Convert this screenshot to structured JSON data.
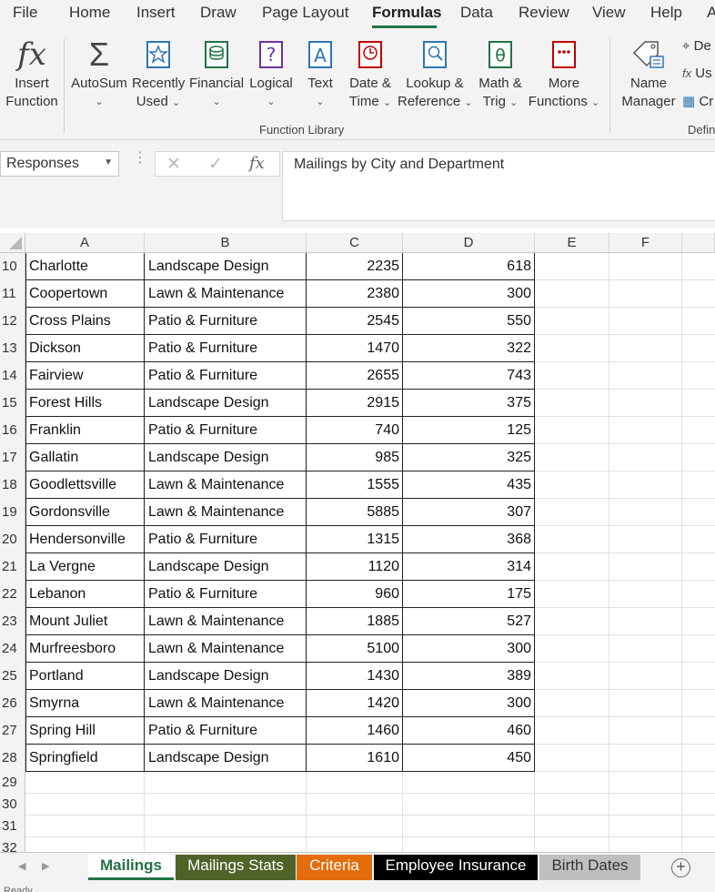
{
  "menu": {
    "tabs": [
      "File",
      "Home",
      "Insert",
      "Draw",
      "Page Layout",
      "Formulas",
      "Data",
      "Review",
      "View",
      "Help",
      "A"
    ],
    "active": "Formulas"
  },
  "ribbon": {
    "insert_function": [
      "Insert",
      "Function"
    ],
    "autosum": "AutoSum",
    "recently_used": [
      "Recently",
      "Used"
    ],
    "financial": "Financial",
    "logical": "Logical",
    "text": "Text",
    "date_time": [
      "Date &",
      "Time"
    ],
    "lookup": [
      "Lookup &",
      "Reference"
    ],
    "math": [
      "Math &",
      "Trig"
    ],
    "more": [
      "More",
      "Functions"
    ],
    "group_label": "Function Library",
    "name_manager": [
      "Name",
      "Manager"
    ],
    "defined_names": [
      "De",
      "Us",
      "Cr"
    ],
    "defined_group_label": "Defin"
  },
  "formula_bar": {
    "name_box": "Responses",
    "fx": "fx",
    "content": "Mailings by City and Department"
  },
  "grid": {
    "columns": [
      "A",
      "B",
      "C",
      "D",
      "E",
      "F"
    ],
    "rows": [
      {
        "row": "10",
        "city": "Charlotte",
        "dept": "Landscape Design",
        "c": "2235",
        "d": "618"
      },
      {
        "row": "11",
        "city": "Coopertown",
        "dept": "Lawn & Maintenance",
        "c": "2380",
        "d": "300"
      },
      {
        "row": "12",
        "city": "Cross Plains",
        "dept": "Patio & Furniture",
        "c": "2545",
        "d": "550"
      },
      {
        "row": "13",
        "city": "Dickson",
        "dept": "Patio & Furniture",
        "c": "1470",
        "d": "322"
      },
      {
        "row": "14",
        "city": "Fairview",
        "dept": "Patio & Furniture",
        "c": "2655",
        "d": "743"
      },
      {
        "row": "15",
        "city": "Forest Hills",
        "dept": "Landscape Design",
        "c": "2915",
        "d": "375"
      },
      {
        "row": "16",
        "city": "Franklin",
        "dept": "Patio & Furniture",
        "c": "740",
        "d": "125"
      },
      {
        "row": "17",
        "city": "Gallatin",
        "dept": "Landscape Design",
        "c": "985",
        "d": "325"
      },
      {
        "row": "18",
        "city": "Goodlettsville",
        "dept": "Lawn & Maintenance",
        "c": "1555",
        "d": "435"
      },
      {
        "row": "19",
        "city": "Gordonsville",
        "dept": "Lawn & Maintenance",
        "c": "5885",
        "d": "307"
      },
      {
        "row": "20",
        "city": "Hendersonville",
        "dept": "Patio & Furniture",
        "c": "1315",
        "d": "368"
      },
      {
        "row": "21",
        "city": "La Vergne",
        "dept": "Landscape Design",
        "c": "1120",
        "d": "314"
      },
      {
        "row": "22",
        "city": "Lebanon",
        "dept": "Patio & Furniture",
        "c": "960",
        "d": "175"
      },
      {
        "row": "23",
        "city": "Mount Juliet",
        "dept": "Lawn & Maintenance",
        "c": "1885",
        "d": "527"
      },
      {
        "row": "24",
        "city": "Murfreesboro",
        "dept": "Lawn & Maintenance",
        "c": "5100",
        "d": "300"
      },
      {
        "row": "25",
        "city": "Portland",
        "dept": "Landscape Design",
        "c": "1430",
        "d": "389"
      },
      {
        "row": "26",
        "city": "Smyrna",
        "dept": "Lawn & Maintenance",
        "c": "1420",
        "d": "300"
      },
      {
        "row": "27",
        "city": "Spring Hill",
        "dept": "Patio & Furniture",
        "c": "1460",
        "d": "460"
      },
      {
        "row": "28",
        "city": "Springfield",
        "dept": "Landscape Design",
        "c": "1610",
        "d": "450"
      }
    ],
    "empty_rows": [
      "29",
      "30",
      "31",
      "32"
    ]
  },
  "sheets": [
    {
      "name": "Mailings",
      "bg": "#ffffff",
      "fg": "#217346",
      "active": true
    },
    {
      "name": "Mailings Stats",
      "bg": "#4f6228",
      "fg": "#ffffff",
      "active": false
    },
    {
      "name": "Criteria",
      "bg": "#e46c0a",
      "fg": "#ffffff",
      "active": false
    },
    {
      "name": "Employee Insurance",
      "bg": "#000000",
      "fg": "#ffffff",
      "active": false
    },
    {
      "name": "Birth Dates",
      "bg": "#bfbfbf",
      "fg": "#333333",
      "active": false
    }
  ],
  "status": "Ready",
  "colors": {
    "accent": "#217346",
    "chrome": "#f3f3f3"
  }
}
